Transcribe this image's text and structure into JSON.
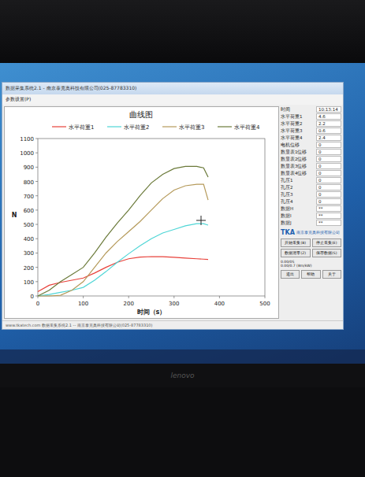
{
  "window": {
    "title": "数据采集系统2.1 - 南京泰克奥科技有限公司(025-87783310)"
  },
  "menu": [
    "参数设置(P)"
  ],
  "chart": {
    "title": "曲线图",
    "y_label": "N",
    "x_label": "时间（s）",
    "y_ticks": [
      "0",
      "100",
      "200",
      "300",
      "400",
      "500",
      "600",
      "700",
      "800",
      "900",
      "1000",
      "1100"
    ],
    "x_ticks": [
      "0",
      "100",
      "200",
      "300",
      "400",
      "500"
    ],
    "x_max": 500,
    "y_max": 1100,
    "times": [
      0,
      25,
      50,
      75,
      100,
      125,
      150,
      175,
      200,
      225,
      250,
      275,
      300,
      325,
      350,
      365,
      375
    ],
    "series": [
      {
        "name": "水平荷重1",
        "color": "#e8413a",
        "values": [
          30,
          75,
          95,
          110,
          125,
          160,
          200,
          235,
          260,
          272,
          275,
          274,
          270,
          265,
          260,
          257,
          255
        ]
      },
      {
        "name": "水平荷重2",
        "color": "#4fd6d6",
        "values": [
          0,
          10,
          25,
          40,
          60,
          110,
          170,
          235,
          295,
          350,
          400,
          440,
          465,
          490,
          505,
          505,
          495
        ]
      },
      {
        "name": "水平荷重3",
        "color": "#b59a5a",
        "values": [
          0,
          0,
          5,
          40,
          100,
          200,
          300,
          380,
          450,
          520,
          600,
          680,
          740,
          770,
          780,
          780,
          670
        ]
      },
      {
        "name": "水平荷重4",
        "color": "#6b7a3a",
        "values": [
          0,
          40,
          100,
          150,
          200,
          300,
          410,
          510,
          600,
          700,
          790,
          850,
          890,
          905,
          905,
          895,
          830
        ]
      }
    ]
  },
  "side_panel": {
    "fields": [
      {
        "label": "时间",
        "value": "10:13:14"
      },
      {
        "label": "水平荷重1",
        "value": "4.6"
      },
      {
        "label": "水平荷重2",
        "value": "2.2"
      },
      {
        "label": "水平荷重3",
        "value": "0.6"
      },
      {
        "label": "水平荷重4",
        "value": "2.4"
      },
      {
        "label": "电机位移",
        "value": "0"
      },
      {
        "label": "数显表1位移",
        "value": "0"
      },
      {
        "label": "数显表2位移",
        "value": "0"
      },
      {
        "label": "数显表3位移",
        "value": "0"
      },
      {
        "label": "数显表4位移",
        "value": "0"
      },
      {
        "label": "孔压1",
        "value": "0"
      },
      {
        "label": "孔压2",
        "value": "0"
      },
      {
        "label": "孔压3",
        "value": "0"
      },
      {
        "label": "孔压4",
        "value": "0"
      },
      {
        "label": "数据H",
        "value": "**"
      },
      {
        "label": "数据I",
        "value": "**"
      },
      {
        "label": "数据J",
        "value": "**"
      }
    ],
    "logo": {
      "mark": "TKA",
      "company": "南京泰克奥科技有限公司"
    },
    "buttons": [
      "开始采集(B)",
      "停止采集(E)",
      "数据清零(Z)",
      "保存数据(S)"
    ],
    "readouts": [
      "0.00/0S",
      "0.00/0.7 (8m/kW)"
    ],
    "footer_buttons": [
      "退出",
      "帮助",
      "关于"
    ]
  },
  "status_bar": "www.tkatech.com  数据采集系统2.1 -- 南京泰克奥科技有限公司(025-87783310)",
  "bezel": {
    "brand": "lenovo"
  }
}
